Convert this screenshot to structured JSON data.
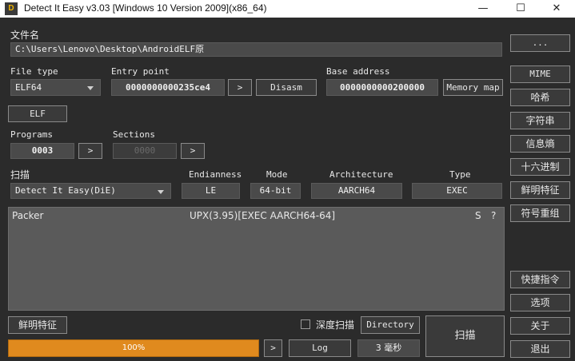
{
  "window": {
    "title": "Detect It Easy v3.03 [Windows 10 Version 2009](x86_64)",
    "logo": "D",
    "min_glyph": "—",
    "max_glyph": "☐",
    "close_glyph": "✕"
  },
  "file": {
    "label": "文件名",
    "path": "C:\\Users\\Lenovo\\Desktop\\AndroidELF原",
    "browse_label": "..."
  },
  "header": {
    "file_type_label": "File type",
    "file_type_value": "ELF64",
    "entry_point_label": "Entry point",
    "entry_point_value": "0000000000235ce4",
    "entry_arrow": ">",
    "disasm_label": "Disasm",
    "base_address_label": "Base address",
    "base_address_value": "0000000000200000",
    "memory_map_label": "Memory map",
    "elf_button": "ELF",
    "programs_label": "Programs",
    "programs_value": "0003",
    "programs_arrow": ">",
    "sections_label": "Sections",
    "sections_value": "0000",
    "sections_arrow": ">"
  },
  "scan": {
    "label": "扫描",
    "engine_value": "Detect It Easy(DiE)",
    "endianness_label": "Endianness",
    "endianness_value": "LE",
    "mode_label": "Mode",
    "mode_value": "64-bit",
    "architecture_label": "Architecture",
    "architecture_value": "AARCH64",
    "type_label": "Type",
    "type_value": "EXEC"
  },
  "results": [
    {
      "name": "Packer",
      "value": "UPX(3.95)[EXEC AARCH64-64]",
      "s": "S",
      "q": "?"
    }
  ],
  "bottom": {
    "signatures_button": "鲜明特征",
    "deep_scan_label": "深度扫描",
    "deep_scan_checked": false,
    "directory_button": "Directory",
    "scan_button": "扫描",
    "progress_text": "100%",
    "progress_value": 100,
    "arrow": ">",
    "log_button": "Log",
    "elapsed": "3 毫秒"
  },
  "sidebar": {
    "top_buttons": [
      "MIME",
      "哈希",
      "字符串",
      "信息熵",
      "十六进制",
      "鲜明特征",
      "符号重组"
    ],
    "bottom_buttons": [
      "快捷指令",
      "选项",
      "关于",
      "退出"
    ]
  },
  "colors": {
    "background": "#2b2b2b",
    "progress": "#e08a1e",
    "result_panel": "#5a5a5a"
  }
}
